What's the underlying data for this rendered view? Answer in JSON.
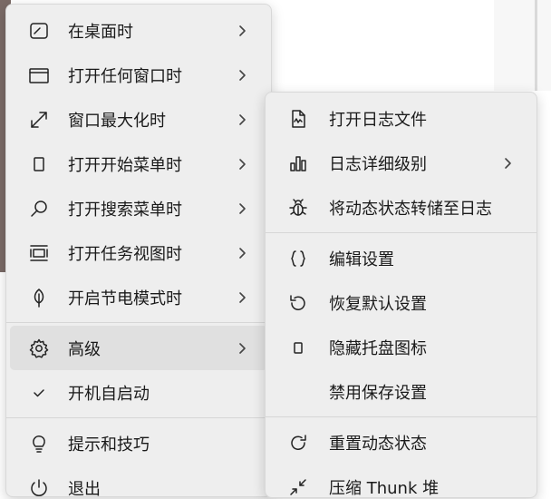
{
  "main_menu": {
    "items": [
      {
        "label": "在桌面时",
        "icon": "desktop-icon",
        "has_submenu": true
      },
      {
        "label": "打开任何窗口时",
        "icon": "window-icon",
        "has_submenu": true
      },
      {
        "label": "窗口最大化时",
        "icon": "maximize-icon",
        "has_submenu": true
      },
      {
        "label": "打开开始菜单时",
        "icon": "start-menu-icon",
        "has_submenu": true
      },
      {
        "label": "打开搜索菜单时",
        "icon": "search-icon",
        "has_submenu": true
      },
      {
        "label": "打开任务视图时",
        "icon": "task-view-icon",
        "has_submenu": true
      },
      {
        "label": "开启节电模式时",
        "icon": "leaf-icon",
        "has_submenu": true
      },
      {
        "label": "高级",
        "icon": "gear-icon",
        "has_submenu": true,
        "active": true
      },
      {
        "label": "开机自启动",
        "icon": "checkmark-icon",
        "has_submenu": false
      },
      {
        "label": "提示和技巧",
        "icon": "lightbulb-icon",
        "has_submenu": false
      },
      {
        "label": "退出",
        "icon": "power-icon",
        "has_submenu": false
      }
    ]
  },
  "advanced_submenu": {
    "items": [
      {
        "label": "打开日志文件",
        "icon": "log-file-icon",
        "has_submenu": false
      },
      {
        "label": "日志详细级别",
        "icon": "bar-chart-icon",
        "has_submenu": true
      },
      {
        "label": "将动态状态转储至日志",
        "icon": "bug-icon",
        "has_submenu": false
      },
      {
        "label": "编辑设置",
        "icon": "braces-icon",
        "has_submenu": false
      },
      {
        "label": "恢复默认设置",
        "icon": "undo-icon",
        "has_submenu": false
      },
      {
        "label": "隐藏托盘图标",
        "icon": "small-square-icon",
        "has_submenu": false
      },
      {
        "label": "禁用保存设置",
        "icon": "",
        "has_submenu": false
      },
      {
        "label": "重置动态状态",
        "icon": "refresh-icon",
        "has_submenu": false
      },
      {
        "label": "压缩 Thunk 堆",
        "icon": "compress-icon",
        "has_submenu": false
      }
    ]
  },
  "colors": {
    "menu_bg": "#eeeeee",
    "active_item_bg": "#e0e0e0",
    "separator": "#d6d6d6"
  }
}
